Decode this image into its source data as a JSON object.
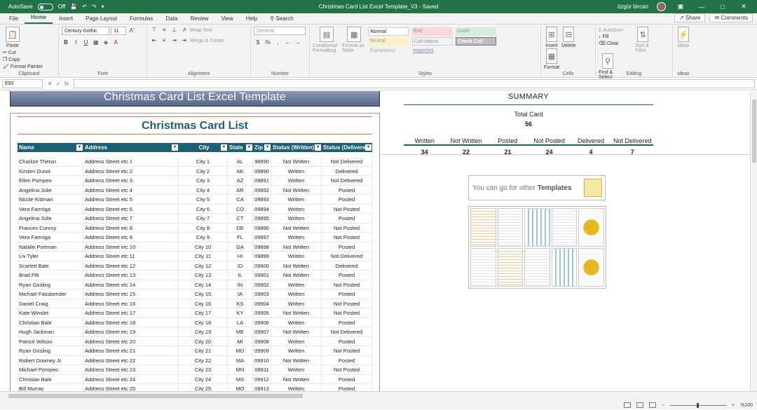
{
  "titlebar": {
    "autosave_label": "AutoSave",
    "autosave_state": "Off",
    "doc_title": "Christmas Card List Excel Template_V3  -  Saved",
    "search_placeholder": "Search",
    "user_name": "özgür bircan"
  },
  "tabs": [
    "File",
    "Home",
    "Insert",
    "Page Layout",
    "Formulas",
    "Data",
    "Review",
    "View",
    "Help"
  ],
  "active_tab": "Home",
  "share_label": "Share",
  "comments_label": "Comments",
  "ribbon": {
    "clipboard": {
      "paste": "Paste",
      "cut": "Cut",
      "copy": "Copy",
      "format_painter": "Format Painter",
      "label": "Clipboard"
    },
    "font": {
      "name": "Century Gothic",
      "size": "11",
      "label": "Font"
    },
    "alignment": {
      "wrap": "Wrap Text",
      "merge": "Merge & Center",
      "label": "Alignment"
    },
    "number": {
      "format": "General",
      "label": "Number"
    },
    "styles": {
      "conditional": "Conditional Formatting",
      "format_table": "Format as Table",
      "cells": [
        "Normal",
        "Bad",
        "Good",
        "Neutral",
        "Calculation",
        "Check Cell",
        "Explanatory ...",
        "Hyperlink"
      ],
      "label": "Styles"
    },
    "cells": {
      "insert": "Insert",
      "delete": "Delete",
      "format": "Format",
      "label": "Cells"
    },
    "editing": {
      "autosum": "AutoSum",
      "fill": "Fill",
      "clear": "Clear",
      "sort": "Sort & Filter",
      "find": "Find & Select",
      "label": "Editing"
    },
    "ideas": {
      "label": "Ideas",
      "btn": "Ideas"
    }
  },
  "formula_bar": {
    "name_box": "E93",
    "fx": "fx"
  },
  "sheet": {
    "banner": "Christmas Card List Excel Template",
    "list_title": "Christmas Card List",
    "columns": [
      "Name",
      "Address",
      "City",
      "State",
      "Zip",
      "Status (Written)",
      "Status (Delivered)"
    ],
    "rows": [
      [
        "Charlize Theron",
        "Address Street etc 1",
        "City 1",
        "AL",
        "98990",
        "Not Written",
        "Not Delivered"
      ],
      [
        "Kirsten Dunst",
        "Address Street etc 2",
        "City 2",
        "AK",
        "09890",
        "Written",
        "Delivered"
      ],
      [
        "Ellen Pompeo",
        "Address Street etc 3",
        "City 3",
        "AZ",
        "09891",
        "Written",
        "Not Delivered"
      ],
      [
        "Angelina Jolie",
        "Address Street etc 4",
        "City 4",
        "AR",
        "09892",
        "Not Written",
        "Posted"
      ],
      [
        "Nicole Kidman",
        "Address Street etc 5",
        "City 5",
        "CA",
        "09893",
        "Written",
        "Posted"
      ],
      [
        "Vera Farmiga",
        "Address Street etc 6",
        "City 6",
        "CO",
        "09894",
        "Written",
        "Not Posted"
      ],
      [
        "Angelina Jolie",
        "Address Street etc 7",
        "City 7",
        "CT",
        "09895",
        "Written",
        "Posted"
      ],
      [
        "Frances Conroy",
        "Address Street etc 8",
        "City 8",
        "DE",
        "09896",
        "Not Written",
        "Not Posted"
      ],
      [
        "Vera Farmiga",
        "Address Street etc 9",
        "City 9",
        "FL",
        "09897",
        "Written",
        "Not Posted"
      ],
      [
        "Natalie Portman",
        "Address Street etc 10",
        "City 10",
        "GA",
        "09898",
        "Not Written",
        "Posted"
      ],
      [
        "Liv Tyler",
        "Address Street etc 11",
        "City 11",
        "HI",
        "09899",
        "Written",
        "Not Delivered"
      ],
      [
        "Scarlett Bale",
        "Address Street etc 12",
        "City 12",
        "ID",
        "09900",
        "Not Written",
        "Delivered"
      ],
      [
        "Brad Pitt",
        "Address Street etc 13",
        "City 13",
        "IL",
        "09901",
        "Not Written",
        "Posted"
      ],
      [
        "Ryan Gosling",
        "Address Street etc 14",
        "City 14",
        "IN",
        "09902",
        "Written",
        "Not Posted"
      ],
      [
        "Michael Fassbender",
        "Address Street etc 15",
        "City 15",
        "IA",
        "09903",
        "Written",
        "Posted"
      ],
      [
        "Daniel Craig",
        "Address Street etc 16",
        "City 16",
        "KS",
        "09904",
        "Written",
        "Not Posted"
      ],
      [
        "Kate Winslet",
        "Address Street etc 17",
        "City 17",
        "KY",
        "09905",
        "Not Written",
        "Not Posted"
      ],
      [
        "Christian Bale",
        "Address Street etc 18",
        "City 18",
        "LA",
        "09906",
        "Written",
        "Posted"
      ],
      [
        "Hugh Jackman",
        "Address Street etc 19",
        "City 19",
        "ME",
        "09907",
        "Not Written",
        "Not Delivered"
      ],
      [
        "Patrick Wilson",
        "Address Street etc 20",
        "City 20",
        "MI",
        "09908",
        "Written",
        "Posted"
      ],
      [
        "Ryan Gosling",
        "Address Street etc 21",
        "City 21",
        "MD",
        "09909",
        "Written",
        "Not Posted"
      ],
      [
        "Robert Downey Jr.",
        "Address Street etc 22",
        "City 22",
        "MA",
        "09910",
        "Not Written",
        "Posted"
      ],
      [
        "Michael Pompeo",
        "Address Street etc 23",
        "City 23",
        "MN",
        "09911",
        "Written",
        "Not Posted"
      ],
      [
        "Christian Bale",
        "Address Street etc 24",
        "City 24",
        "MS",
        "09912",
        "Not Written",
        "Posted"
      ],
      [
        "Bill Murray",
        "Address Street etc 25",
        "City 25",
        "MO",
        "09913",
        "Written",
        "Posted"
      ]
    ],
    "summary": {
      "title": "SUMMARY",
      "total_label": "Total Card",
      "total_value": "56",
      "labels": [
        "Written",
        "Not Written",
        "Posted",
        "Not Posted",
        "Delivered",
        "Not Delivered"
      ],
      "values": [
        "34",
        "22",
        "21",
        "24",
        "4",
        "7"
      ]
    },
    "promo": {
      "prefix": "You can go for other",
      "bold": "Templates"
    }
  },
  "status": {
    "zoom": "%100"
  },
  "colors": {
    "accent": "#217346",
    "table_header": "#1c5e74",
    "title_rule": "#e0734a"
  }
}
